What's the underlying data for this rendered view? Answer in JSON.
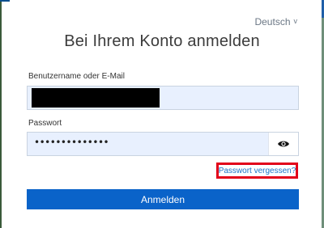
{
  "header": {
    "language_label": "Deutsch",
    "language_chevron": "v",
    "title": "Bei Ihrem Konto anmelden"
  },
  "form": {
    "username_label": "Benutzername oder E-Mail",
    "password_label": "Passwort",
    "password_value": "••••••••••••••",
    "forgot_link": "Passwort vergessen?",
    "submit_label": "Anmelden"
  },
  "icons": {
    "show_password": "eye-icon",
    "language": "chevron-down-icon"
  },
  "colors": {
    "primary": "#0a63c9",
    "input_bg": "#e8f0fe",
    "highlight": "#e2001a",
    "link": "#1a73c8"
  }
}
